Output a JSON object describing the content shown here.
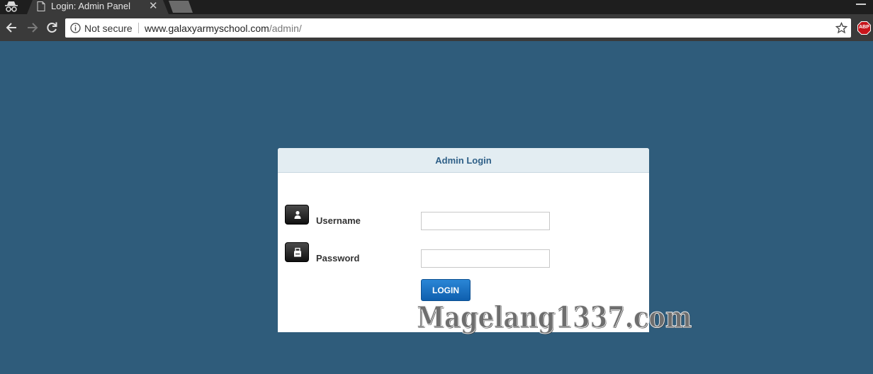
{
  "browser": {
    "tab": {
      "title": "Login: Admin Panel",
      "close_glyph": "✕"
    },
    "omnibox": {
      "security_label": "Not secure",
      "url_host": "www.galaxyarmyschool.com",
      "url_path": "/admin/"
    },
    "extension": {
      "label": "ABP",
      "color": "#c7151b"
    },
    "icons": [
      "incognito-icon",
      "page-icon",
      "back-icon",
      "forward-icon",
      "reload-icon",
      "info-icon",
      "star-icon",
      "adblock-icon"
    ]
  },
  "login": {
    "title": "Admin Login",
    "username_label": "Username",
    "username_value": "",
    "password_label": "Password",
    "password_value": "",
    "login_label": "LOGIN"
  },
  "watermark": "Magelang1337.com",
  "colors": {
    "page_background": "#2f5c7b",
    "header_background": "#e3edf2",
    "title_color": "#2e5f87",
    "button_color": "#1a73c8"
  }
}
